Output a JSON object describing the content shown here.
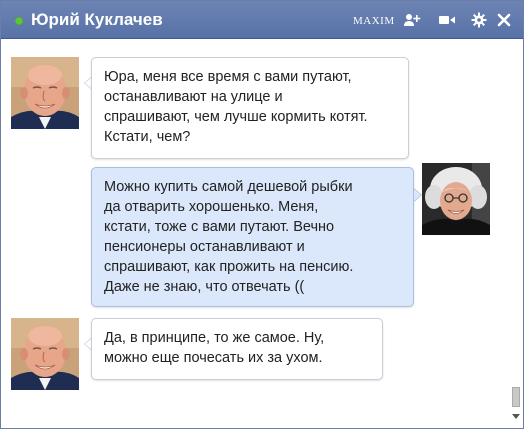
{
  "titlebar": {
    "title": "Юрий Куклачев",
    "brand": "MAXIM",
    "status_color": "#5ec53a",
    "icons": [
      "add-friend-icon",
      "video-call-icon",
      "gear-icon",
      "close-icon"
    ]
  },
  "messages": [
    {
      "sender": "other",
      "avatar_icon": "bald-man-avatar",
      "text": "Юра, меня все время с вами путают,\nостанавливают на улице и\nспрашивают, чем лучше кормить котят.\nКстати, чем?"
    },
    {
      "sender": "self",
      "avatar_icon": "white-haired-man-avatar",
      "text": "Можно купить самой дешевой рыбки\nда отварить хорошенько. Меня,\nкстати, тоже с вами путают. Вечно\nпенсионеры останавливают и\nспрашивают, как прожить на пенсию.\nДаже не знаю, что отвечать (("
    },
    {
      "sender": "other",
      "avatar_icon": "bald-man-avatar",
      "text": "Да, в принципе, то же самое. Ну,\nможно еще почесать их за ухом."
    }
  ],
  "colors": {
    "titlebar": "#5872a7",
    "incoming_bubble": "#ffffff",
    "outgoing_bubble": "#dbe8fb"
  }
}
